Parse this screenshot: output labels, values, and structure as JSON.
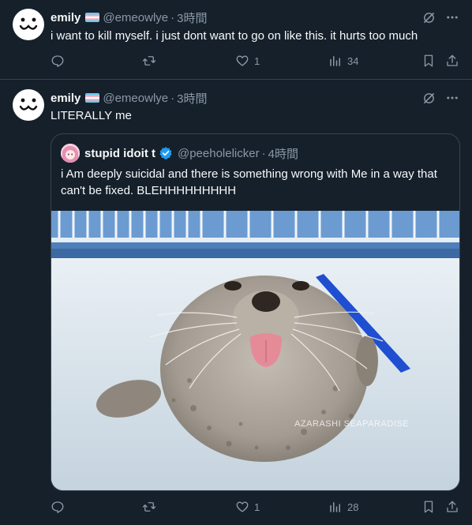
{
  "post1": {
    "display_name": "emily",
    "handle": "@emeowlye",
    "separator": "·",
    "timestamp": "3時間",
    "text": "i want to kill myself. i just dont want to go on like this. it hurts too much",
    "actions": {
      "likes": "1",
      "views": "34"
    }
  },
  "post2": {
    "display_name": "emily",
    "handle": "@emeowlye",
    "separator": "·",
    "timestamp": "3時間",
    "text": "LITERALLY me",
    "quote": {
      "display_name": "stupid idoit t",
      "handle": "@peeholelicker",
      "separator": "·",
      "timestamp": "4時間",
      "text": "i Am deeply suicidal and there is something wrong with Me in a way that can't be fixed. BLEHHHHHHHHH",
      "media_watermark": "AZARASHI SEAPARADISE"
    },
    "actions": {
      "likes": "1",
      "views": "28"
    }
  },
  "colors": {
    "background": "#15202b",
    "text": "#f7f9f9",
    "muted": "#8b98a5",
    "border": "#38444d",
    "verified": "#1d9bf0"
  },
  "icons": [
    "grok-icon",
    "more-icon",
    "reply-icon",
    "repost-icon",
    "like-icon",
    "views-icon",
    "bookmark-icon",
    "share-icon",
    "verified-badge-icon",
    "trans-flag-icon"
  ]
}
